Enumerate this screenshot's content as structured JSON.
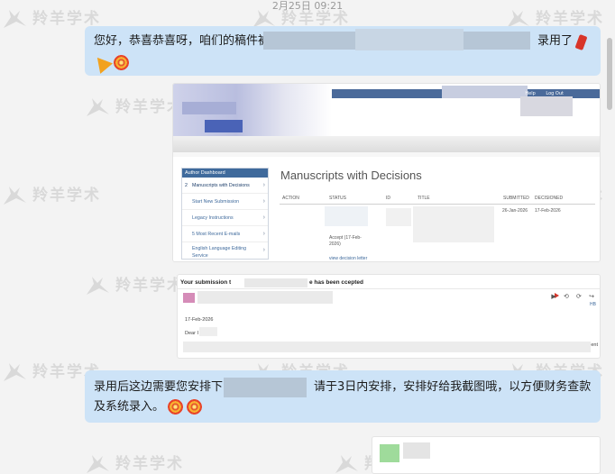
{
  "chat": {
    "timestamp": "2月25日 09:21",
    "msg1": {
      "prefix": "您好，恭喜恭喜呀，咱们的稿件被",
      "suffix": "录用了"
    },
    "msg2": {
      "line1_prefix": "录用后这边需要您安排下",
      "line1_suffix": "请于3日内安排，安排好给我截图哦，以方便财务查款",
      "line2": "及系统录入。"
    }
  },
  "dashboard_screenshot": {
    "header_links": [
      "Help",
      "Log Out"
    ],
    "panel_title": "Author Dashboard",
    "panel_items": [
      {
        "count": "2",
        "label": "Manuscripts with Decisions"
      },
      {
        "label": "Start New Submission"
      },
      {
        "label": "Legacy Instructions"
      },
      {
        "label": "5 Most Recent E-mails"
      },
      {
        "label": "English Language Editing Service"
      }
    ],
    "main_title": "Manuscripts with Decisions",
    "columns": [
      "ACTION",
      "STATUS",
      "ID",
      "TITLE",
      "SUBMITTED",
      "DECISIONED"
    ],
    "row": {
      "submitted": "26-Jan-2026",
      "decisioned": "17-Feb-2026",
      "status": "Accept (17-Feb-2026)",
      "link": "view decision letter"
    }
  },
  "email_screenshot": {
    "subject_start": "Your submission t",
    "subject_end": "e has been  ccepted",
    "date": "17-Feb-2026",
    "greeting": "Dear I",
    "right_icons": "▶ ⟲ ⟳ ↪",
    "right_text": "ent",
    "small_right": "HB"
  },
  "watermark": {
    "text": "羚羊学术"
  },
  "colors": {
    "bubble": "#cde3f7",
    "header_blue": "#4a6a9c",
    "background": "#f3f3f3"
  }
}
